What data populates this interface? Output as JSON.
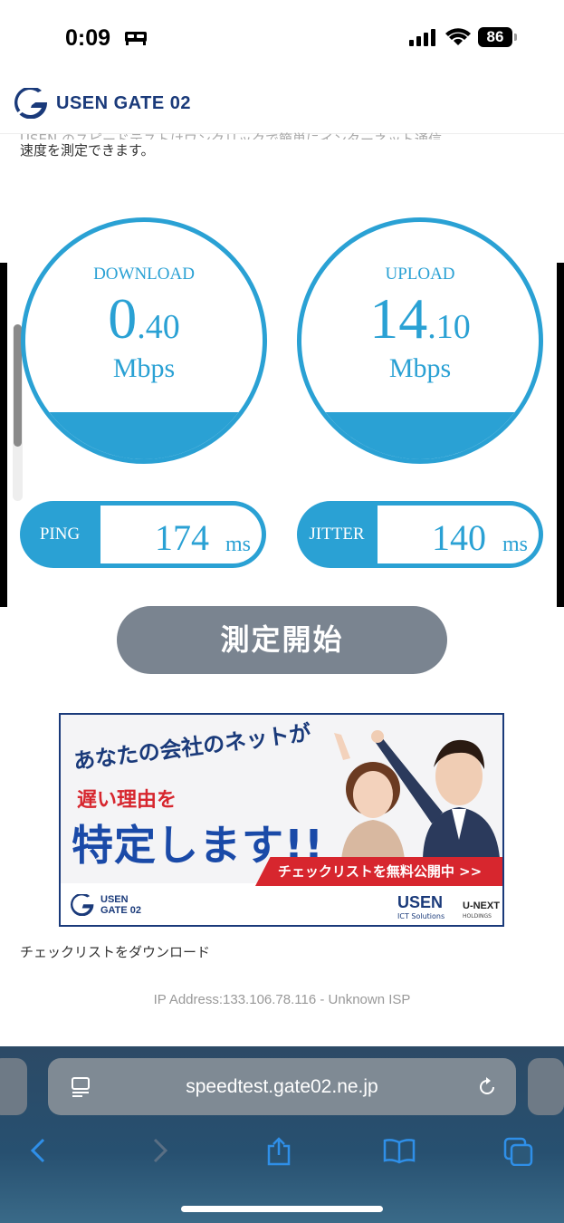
{
  "status_bar": {
    "time": "0:09",
    "battery": "86"
  },
  "header": {
    "logo_text": "USEN GATE 02"
  },
  "intro": {
    "line1": "USEN のスピードテストはワンクリックで簡単にインターネット通信",
    "line2": "速度を測定できます。"
  },
  "download": {
    "title": "DOWNLOAD",
    "value_int": "0",
    "value_dec": ".40",
    "unit": "Mbps",
    "fill_fraction": 0.2
  },
  "upload": {
    "title": "UPLOAD",
    "value_int": "14",
    "value_dec": ".10",
    "unit": "Mbps",
    "fill_fraction": 0.2
  },
  "ping": {
    "label": "PING",
    "value": "174",
    "unit": "ms"
  },
  "jitter": {
    "label": "JITTER",
    "value": "140",
    "unit": "ms"
  },
  "start_button": "測定開始",
  "banner": {
    "line1": "あなたの会社のネットが",
    "line2": "遅い理由を",
    "line3": "特定します!!",
    "cta": "チェックリストを無料公開中 >>",
    "logo": "USEN GATE 02",
    "usen": "USEN",
    "usen_sub": "ICT Solutions",
    "unext": "U-NEXT",
    "unext_sub": "HOLDINGS"
  },
  "checklist_link": "チェックリストをダウンロード",
  "ip_info": "IP Address:133.106.78.116 - Unknown ISP",
  "browser": {
    "url": "speedtest.gate02.ne.jp"
  },
  "colors": {
    "accent": "#2aa1d4",
    "button": "#7a8490",
    "brand": "#1a3a7a",
    "cta": "#d7262e"
  }
}
